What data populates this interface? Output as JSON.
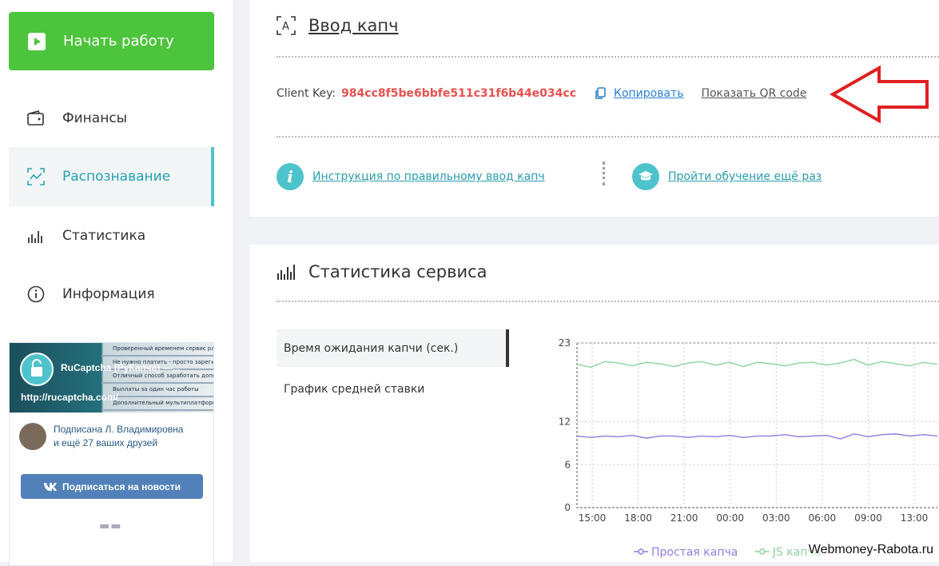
{
  "sidebar": {
    "start_label": "Начать работу",
    "items": [
      {
        "label": "Финансы"
      },
      {
        "label": "Распознавание"
      },
      {
        "label": "Статистика"
      },
      {
        "label": "Информация"
      }
    ],
    "vk": {
      "title": "RuCaptcha (РуКапча) —...",
      "url": "http://rucaptcha.com/",
      "subscribed_line1": "Подписана Л. Владимировна",
      "subscribed_line2": "и ещё 27 ваших друзей",
      "subscribe_button": "Подписаться на новости",
      "banner_lines": [
        "Проверенный временем сервис распо",
        "Не нужно платить - просто зарегистр",
        "Отличный способ заработать дополнит",
        "Выплаты за один час работы",
        "Дополнительный мультиплатформенный"
      ]
    }
  },
  "captcha": {
    "title": "Ввод капч",
    "client_key_label": "Client Key:",
    "client_key": "984cc8f5be6bbfe511c31f6b44e034cc",
    "copy_label": "Копировать",
    "qr_label": "Показать QR code",
    "instruction_link": "Инструкция по правильному ввод капч",
    "training_link": "Пройти обучение ещё раз"
  },
  "stats": {
    "title": "Статистика сервиса",
    "tabs": [
      {
        "label": "Время ожидания капчи (сек.)"
      },
      {
        "label": "График средней ставки"
      }
    ]
  },
  "chart_data": {
    "type": "line",
    "x_ticks": [
      "15:00",
      "18:00",
      "21:00",
      "00:00",
      "03:00",
      "06:00",
      "09:00",
      "13:00"
    ],
    "y_ticks": [
      "0",
      "6",
      "12",
      "23"
    ],
    "ylim": [
      0,
      23
    ],
    "series": [
      {
        "name": "Простая капча",
        "color": "#8c7ee0",
        "values": [
          10,
          9.8,
          10,
          9.9,
          10.1,
          9.7,
          10,
          10,
          9.8,
          10,
          9.9,
          10.1,
          9.8,
          10,
          10,
          10.2,
          9.9,
          10,
          10.1,
          9.6,
          10.3,
          9.9,
          10.2,
          10.3,
          10,
          10.2,
          10
        ]
      },
      {
        "name": "JS капча",
        "color": "#8ad3a0",
        "values": [
          20,
          19.6,
          20.4,
          20.2,
          19.8,
          20.3,
          20.1,
          19.7,
          20.2,
          20.4,
          19.9,
          20.3,
          19.7,
          20.3,
          20.1,
          19.8,
          20.2,
          20.3,
          19.9,
          20.2,
          20.7,
          19.9,
          20.4,
          20.1,
          19.8,
          20.3,
          20
        ]
      }
    ],
    "legend": [
      "Простая капча",
      "JS капча"
    ]
  },
  "watermark": "Webmoney-Rabota.ru",
  "colors": {
    "accent": "#4ec3cc",
    "start": "#4cc43b",
    "key": "#e8514f",
    "arrow": "#e02020"
  }
}
